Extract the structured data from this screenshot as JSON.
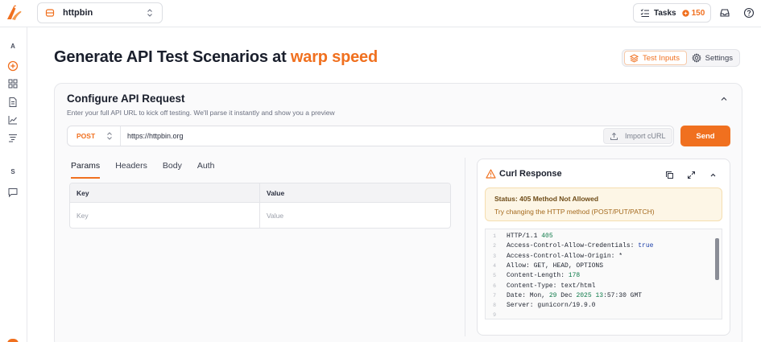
{
  "colors": {
    "accent": "#f0701f",
    "warning_bg": "#fdf6e6",
    "warning_text": "#6e4b17"
  },
  "topbar": {
    "workspace": {
      "name": "httpbin",
      "icon": "server-icon"
    },
    "tasks": {
      "label": "Tasks",
      "count": "150"
    }
  },
  "sidebar": {
    "letters": [
      "A",
      "S"
    ]
  },
  "header": {
    "title_prefix": "Generate API Test Scenarios at",
    "title_accent": "warp speed",
    "mode_tabs": [
      {
        "label": "Test Inputs",
        "active": true
      },
      {
        "label": "Settings",
        "active": false
      }
    ]
  },
  "request": {
    "title": "Configure API Request",
    "subtitle": "Enter your full API URL to kick off testing. We'll parse it instantly and show you a preview",
    "method": "POST",
    "url": "https://httpbin.org",
    "import_label": "Import cURL",
    "send_label": "Send",
    "tabs": [
      "Params",
      "Headers",
      "Body",
      "Auth"
    ],
    "active_tab": "Params",
    "table": {
      "headers": [
        "Key",
        "Value"
      ],
      "placeholders": [
        "Key",
        "Value"
      ]
    }
  },
  "response": {
    "title": "Curl Response",
    "status_title": "Status: 405 Method Not Allowed",
    "status_hint": "Try changing the HTTP method (POST/PUT/PATCH)",
    "lines": [
      {
        "n": "1",
        "parts": [
          [
            "plain",
            "HTTP/1.1 "
          ],
          [
            "num",
            "405"
          ]
        ]
      },
      {
        "n": "2",
        "parts": [
          [
            "plain",
            "Access-Control-Allow-Credentials: "
          ],
          [
            "kw",
            "true"
          ]
        ]
      },
      {
        "n": "3",
        "parts": [
          [
            "plain",
            "Access-Control-Allow-Origin: *"
          ]
        ]
      },
      {
        "n": "4",
        "parts": [
          [
            "plain",
            "Allow: GET, HEAD, OPTIONS"
          ]
        ]
      },
      {
        "n": "5",
        "parts": [
          [
            "plain",
            "Content-Length: "
          ],
          [
            "num",
            "178"
          ]
        ]
      },
      {
        "n": "6",
        "parts": [
          [
            "plain",
            "Content-Type: text/html"
          ]
        ]
      },
      {
        "n": "7",
        "parts": [
          [
            "plain",
            "Date: Mon, "
          ],
          [
            "num",
            "29"
          ],
          [
            "plain",
            " Dec "
          ],
          [
            "num",
            "2025"
          ],
          [
            "plain",
            " "
          ],
          [
            "num",
            "13"
          ],
          [
            "plain",
            ":57:30 GMT"
          ]
        ]
      },
      {
        "n": "8",
        "parts": [
          [
            "plain",
            "Server: gunicorn/19.9.0"
          ]
        ]
      },
      {
        "n": "9",
        "parts": []
      }
    ]
  }
}
